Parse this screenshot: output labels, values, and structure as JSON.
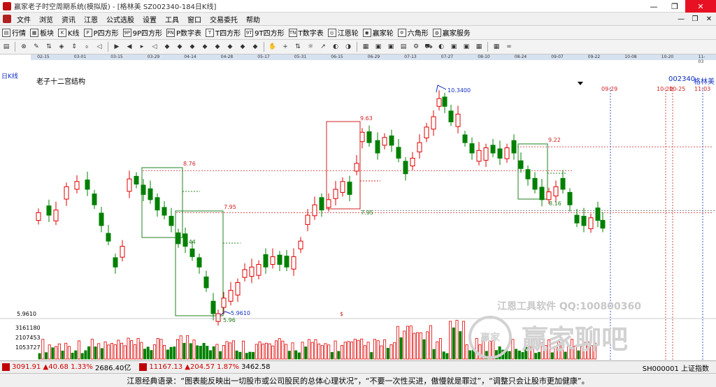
{
  "window": {
    "title": "赢家老子时空周期系统(模拟版) - [格林美  SZ002340-184日K线]",
    "minimize": "—",
    "restore": "❐",
    "close": "✕"
  },
  "menu": [
    "文件",
    "浏览",
    "资讯",
    "江恩",
    "公式选股",
    "设置",
    "工具",
    "窗口",
    "交易委托",
    "帮助"
  ],
  "toolbar1": [
    {
      "icon": "list-icon",
      "glyph": "▤",
      "label": "行情"
    },
    {
      "icon": "grid-icon",
      "glyph": "▦",
      "label": "板块"
    },
    {
      "icon": "candle-icon",
      "glyph": "K",
      "label": "K线"
    },
    {
      "icon": "p-square-icon",
      "glyph": "P",
      "label": "P四方形"
    },
    {
      "icon": "9p-square-icon",
      "glyph": "9P",
      "label": "9P四方形"
    },
    {
      "icon": "pn-square-icon",
      "glyph": "PN",
      "label": "P数字表"
    },
    {
      "icon": "t-square-icon",
      "glyph": "T",
      "label": "T四方形"
    },
    {
      "icon": "9t-square-icon",
      "glyph": "9T",
      "label": "9T四方形"
    },
    {
      "icon": "tn-square-icon",
      "glyph": "TN",
      "label": "T数字表"
    },
    {
      "icon": "gann-wheel-icon",
      "glyph": "◎",
      "label": "江恩轮"
    },
    {
      "icon": "winner-wheel-icon",
      "glyph": "◉",
      "label": "赢家轮"
    },
    {
      "icon": "hexagon-icon",
      "glyph": "✡",
      "label": "六角形"
    },
    {
      "icon": "service-icon",
      "glyph": "◍",
      "label": "赢家服务"
    }
  ],
  "toolbar2": [
    "▤",
    "⊗",
    "✎",
    "⇅",
    "◈",
    "⇕",
    "₀",
    "◁",
    "▶",
    "◀",
    "▸",
    "◁",
    "◆",
    "◆",
    "◆",
    "◆",
    "◆",
    "◆",
    "◆",
    "◆",
    "✋",
    "+",
    "⇅",
    "☼",
    "↗",
    "◐",
    "◑",
    "▦",
    "▣",
    "▣",
    "▤",
    "⚙",
    "⛟",
    "◐",
    "▣",
    "▣",
    "▦",
    "▦",
    "∞"
  ],
  "dates": [
    "02-15",
    "03-01",
    "03-15",
    "03-29",
    "04-14",
    "04-28",
    "05-17",
    "05-31",
    "06-15",
    "06-29",
    "07-13",
    "07-27",
    "08-10",
    "08-24",
    "09-07",
    "09-22",
    "10-08",
    "10-20",
    "11-03"
  ],
  "period_label": "日K线",
  "indicator_name": "老子十二宫结构",
  "stock": {
    "code": "002340",
    "name": "格林美"
  },
  "future_dates": [
    "09-29",
    "10-20",
    "10-25",
    "11-03"
  ],
  "price_labels": {
    "high": "10.3400",
    "p963": "9.63",
    "p922": "9.22",
    "p876": "8.76",
    "p816": "8.16",
    "p795": "7.95",
    "p795b": "7.95",
    "p744": "7.44",
    "low": "5.9610",
    "low_short": "5.96",
    "axis_low": "5.9610",
    "marker": "$"
  },
  "volume_axis": [
    "3161180",
    "2107453",
    "1053727"
  ],
  "watermark": {
    "line1": "江恩工具软件  QQ:100800360",
    "logo": "赢家",
    "line2": "赢家聊吧"
  },
  "status": {
    "sh_index": "3091.91",
    "sh_change": "▲40.68",
    "sh_pct": "1.33%",
    "sh_amount": "2686.40亿",
    "sz_index": "11167.13",
    "sz_change": "▲204.57",
    "sz_pct": "1.87%",
    "sz_amount": "3462.58",
    "ticker": "SH000001 上证指数"
  },
  "quote": "江恩经典语录：“图表能反映出一切股市或公司股民的总体心理状况”，“不要一次性买进，傲慢就是罪过”，“调整只会让股市更加健康”。",
  "colors": {
    "up": "#e00000",
    "down": "#008000",
    "box": "#208020",
    "redbox": "#d02020",
    "blue": "#1030c0"
  }
}
